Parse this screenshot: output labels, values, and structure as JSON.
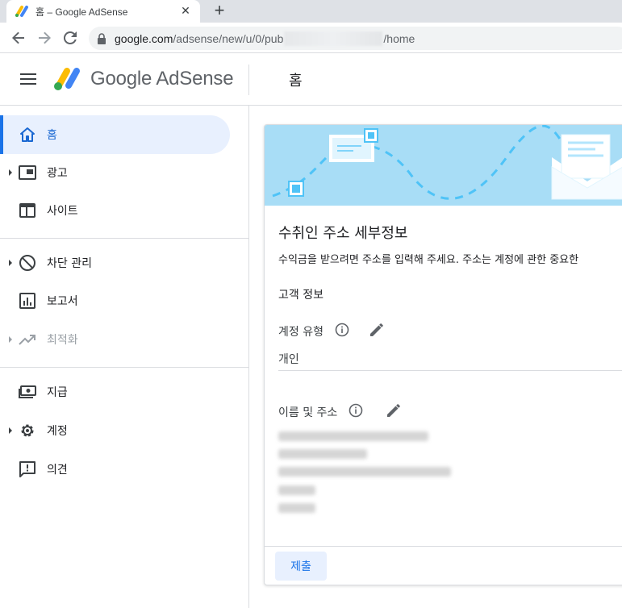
{
  "browser": {
    "tab_title": "홈 – Google AdSense",
    "url_host": "google.com",
    "url_path_start": "/adsense/new/u/0/pub",
    "url_path_end": "/home"
  },
  "header": {
    "brand": "Google AdSense",
    "page_title": "홈"
  },
  "sidebar": {
    "items": [
      {
        "label": "홈",
        "icon": "home-icon"
      },
      {
        "label": "광고",
        "icon": "ads-icon"
      },
      {
        "label": "사이트",
        "icon": "sites-icon"
      },
      {
        "label": "차단 관리",
        "icon": "block-icon"
      },
      {
        "label": "보고서",
        "icon": "reports-icon"
      },
      {
        "label": "최적화",
        "icon": "trending-icon"
      },
      {
        "label": "지급",
        "icon": "payments-icon"
      },
      {
        "label": "계정",
        "icon": "gear-icon"
      },
      {
        "label": "의견",
        "icon": "feedback-icon"
      }
    ]
  },
  "card": {
    "title": "수취인 주소 세부정보",
    "description": "수익금을 받으려면 주소를 입력해 주세요. 주소는 계정에 관한 중요한",
    "section_title": "고객 정보",
    "account_type_label": "계정 유형",
    "account_type_value": "개인",
    "name_address_label": "이름 및 주소",
    "submit_label": "제출"
  },
  "colors": {
    "accent": "#1a73e8",
    "active_bg": "#e8f0fe",
    "banner_bg": "#a8ddf6"
  }
}
